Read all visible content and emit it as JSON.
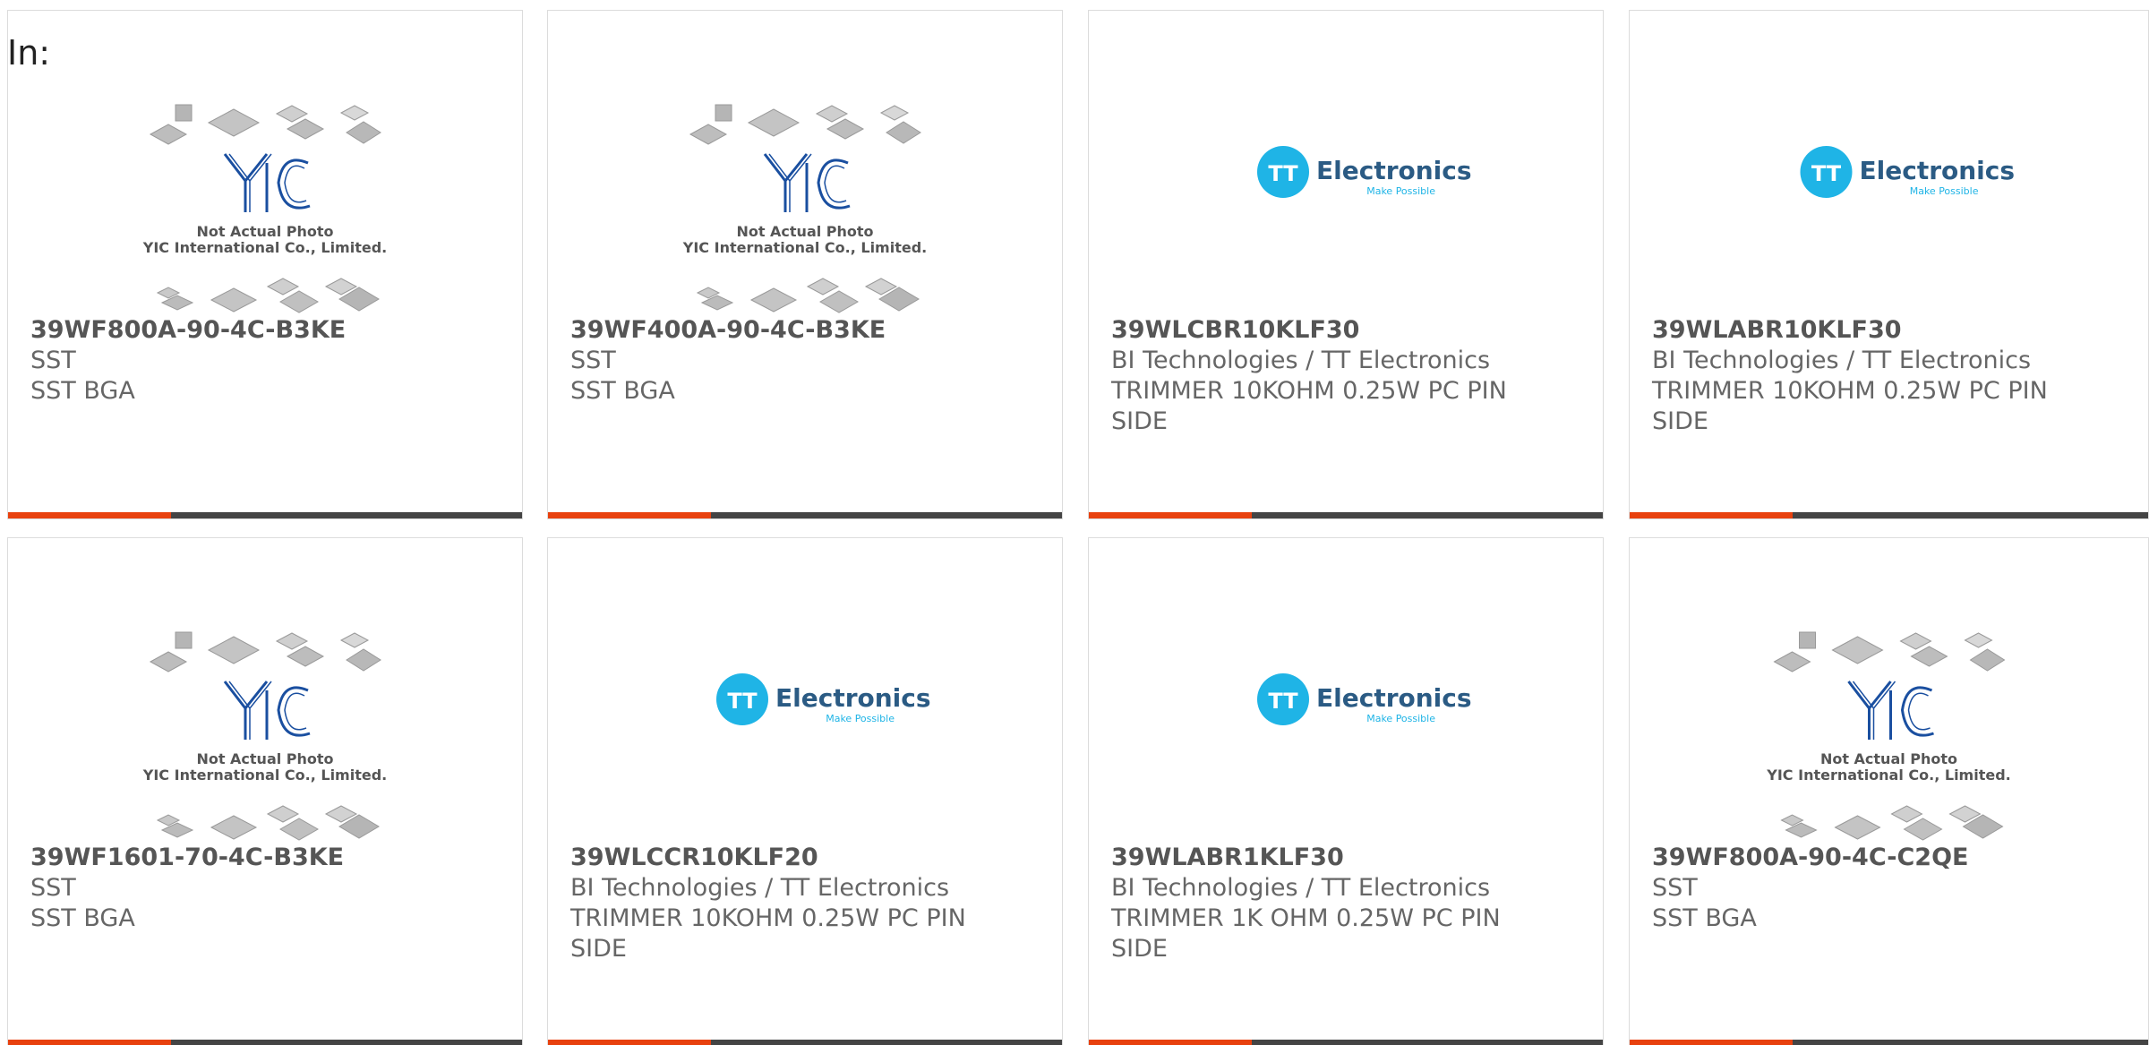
{
  "filter_label": "In:",
  "colors": {
    "accent": "#e8410e",
    "bar": "#444444",
    "yic_blue": "#1a4fa0",
    "tt_blue": "#1fb4e6"
  },
  "placeholder_yic": {
    "line1": "Not Actual Photo",
    "line2": "YIC International Co., Limited."
  },
  "logo_tt": {
    "mark": "TT",
    "word": "Electronics",
    "tagline": "Make Possible"
  },
  "products": [
    {
      "image": "yic-placeholder",
      "part": "39WF800A-90-4C-B3KE",
      "manufacturer": "SST",
      "desc1": "SST BGA",
      "desc2": ""
    },
    {
      "image": "yic-placeholder",
      "part": "39WF400A-90-4C-B3KE",
      "manufacturer": "SST",
      "desc1": "SST BGA",
      "desc2": ""
    },
    {
      "image": "tt-logo",
      "part": "39WLCBR10KLF30",
      "manufacturer": "BI Technologies / TT Electronics",
      "desc1": "TRIMMER 10KOHM 0.25W PC PIN",
      "desc2": "SIDE"
    },
    {
      "image": "tt-logo",
      "part": "39WLABR10KLF30",
      "manufacturer": "BI Technologies / TT Electronics",
      "desc1": "TRIMMER 10KOHM 0.25W PC PIN",
      "desc2": "SIDE"
    },
    {
      "image": "yic-placeholder",
      "part": "39WF1601-70-4C-B3KE",
      "manufacturer": "SST",
      "desc1": "SST BGA",
      "desc2": ""
    },
    {
      "image": "tt-logo",
      "part": "39WLCCR10KLF20",
      "manufacturer": "BI Technologies / TT Electronics",
      "desc1": "TRIMMER 10KOHM 0.25W PC PIN",
      "desc2": "SIDE"
    },
    {
      "image": "tt-logo",
      "part": "39WLABR1KLF30",
      "manufacturer": "BI Technologies / TT Electronics",
      "desc1": "TRIMMER 1K OHM 0.25W PC PIN",
      "desc2": "SIDE"
    },
    {
      "image": "yic-placeholder",
      "part": "39WF800A-90-4C-C2QE",
      "manufacturer": "SST",
      "desc1": "SST BGA",
      "desc2": ""
    }
  ]
}
